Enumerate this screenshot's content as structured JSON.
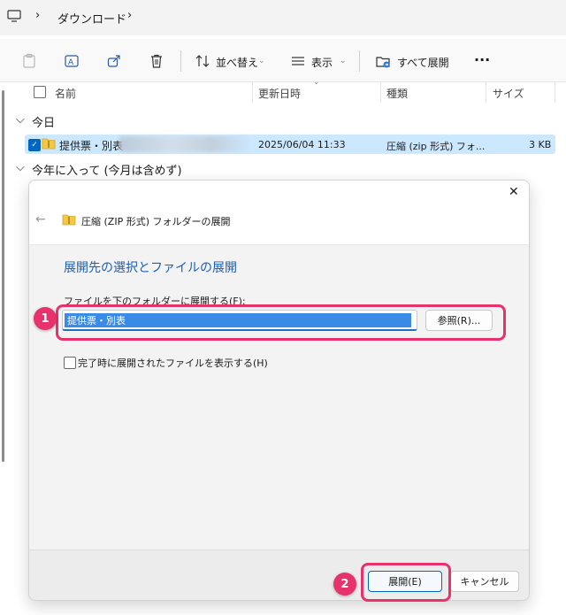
{
  "breadcrumb": {
    "segment": "ダウンロード",
    "sep": "›"
  },
  "toolbar": {
    "sort_label": "並べ替え",
    "view_label": "表示",
    "extract_all_label": "すべて展開",
    "more_label": "···"
  },
  "columns": {
    "name": "名前",
    "modified": "更新日時",
    "type": "種類",
    "size": "サイズ"
  },
  "groups": {
    "today": "今日",
    "this_year": "今年に入って (今月は含めず)"
  },
  "file_row": {
    "name": "提供票・別表",
    "modified": "2025/06/04 11:33",
    "type": "圧縮 (zip 形式) フォ...",
    "size": "3 KB"
  },
  "dialog": {
    "title": "圧縮 (ZIP 形式) フォルダーの展開",
    "close": "✕",
    "heading": "展開先の選択とファイルの展開",
    "field_label": "ファイルを下のフォルダーに展開する(F):",
    "field_value": "提供票・別表",
    "browse_label": "参照(R)...",
    "show_files_label": "完了時に展開されたファイルを表示する(H)",
    "extract_label": "展開(E)",
    "cancel_label": "キャンセル"
  },
  "annotations": {
    "badge1": "1",
    "badge2": "2"
  },
  "colors": {
    "accent": "#0067c0",
    "highlight": "#e8326b",
    "heading_blue": "#1a5fb4"
  }
}
